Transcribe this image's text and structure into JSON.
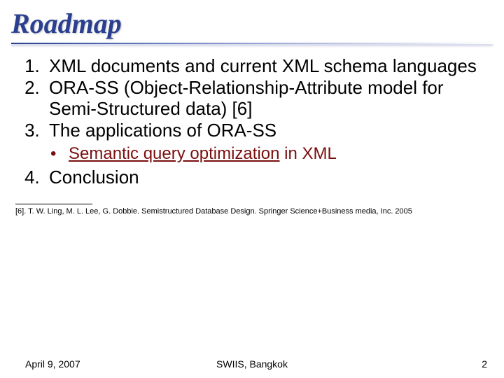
{
  "title": "Roadmap",
  "items": {
    "i1": "XML documents and current XML schema languages",
    "i2": "ORA-SS (Object-Relationship-Attribute model for Semi-Structured data) [6]",
    "i3": "The applications of ORA-SS",
    "i3_sub_underlined": "Semantic query optimization",
    "i3_sub_tail": " in XML",
    "i4": "Conclusion"
  },
  "reference": "[6]. T. W. Ling, M. L. Lee, G. Dobbie. Semistructured Database Design. Springer Science+Business media, Inc. 2005",
  "footer": {
    "date": "April 9, 2007",
    "venue": "SWIIS, Bangkok",
    "page": "2"
  }
}
